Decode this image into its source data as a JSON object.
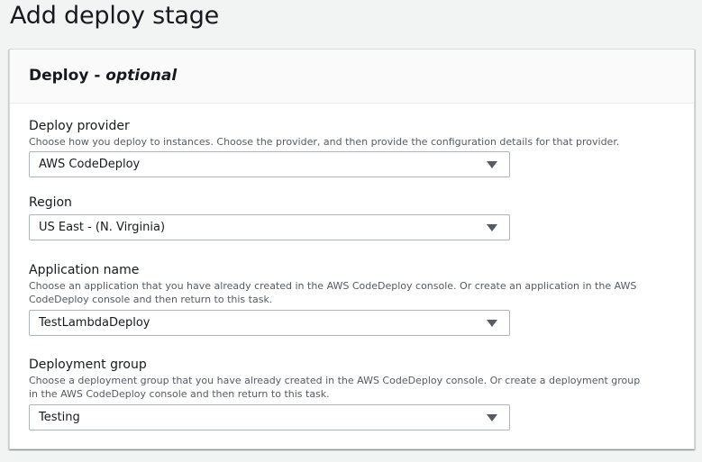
{
  "page": {
    "title": "Add deploy stage"
  },
  "panel": {
    "heading": "Deploy -",
    "heading_optional": "optional"
  },
  "fields": {
    "deploy_provider": {
      "label": "Deploy provider",
      "description": "Choose how you deploy to instances. Choose the provider, and then provide the configuration details for that provider.",
      "value": "AWS CodeDeploy"
    },
    "region": {
      "label": "Region",
      "value": "US East - (N. Virginia)"
    },
    "application_name": {
      "label": "Application name",
      "description": "Choose an application that you have already created in the AWS CodeDeploy console. Or create an application in the AWS CodeDeploy console and then return to this task.",
      "value": "TestLambdaDeploy"
    },
    "deployment_group": {
      "label": "Deployment group",
      "description": "Choose a deployment group that you have already created in the AWS CodeDeploy console. Or create a deployment group in the AWS CodeDeploy console and then return to this task.",
      "value": "Testing"
    }
  },
  "icons": {
    "dropdown": "caret-down-icon"
  },
  "colors": {
    "panel_header_bg": "#fafafa",
    "border": "#aab7b8",
    "text": "#16191f",
    "muted_text": "#545b64"
  }
}
